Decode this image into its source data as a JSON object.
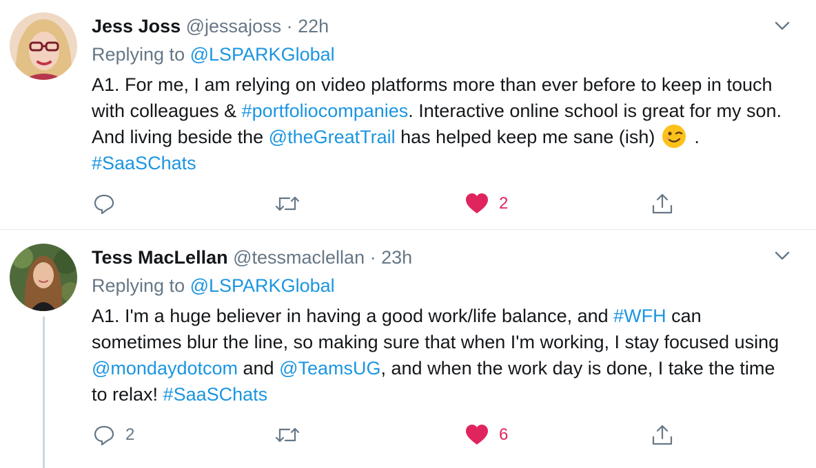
{
  "tweets": [
    {
      "author_name": "Jess Joss",
      "handle": "@jessajoss",
      "separator": "·",
      "time": "22h",
      "replying_prefix": "Replying to",
      "replying_to": "@LSPARKGlobal",
      "body": {
        "t1": "A1. For me, I am relying on video platforms more than ever before to keep in touch with colleagues & ",
        "h1": "#portfoliocompanies",
        "t2": ". Interactive online school is great for my son. And living beside the ",
        "m1": "@theGreatTrail",
        "t3": " has helped keep me sane (ish) ",
        "t4": " . ",
        "h2": "#SaaSChats"
      },
      "emoji": "winking-face",
      "reply_count": "",
      "retweet_count": "",
      "like_count": "2"
    },
    {
      "author_name": "Tess MacLellan",
      "handle": "@tessmaclellan",
      "separator": "·",
      "time": "23h",
      "replying_prefix": "Replying to",
      "replying_to": "@LSPARKGlobal",
      "body": {
        "t1": "A1. I'm a huge believer in having a good work/life balance, and ",
        "h1": "#WFH",
        "t2": " can sometimes blur the line, so making sure that when I'm working, I stay focused using ",
        "m1": "@mondaydotcom",
        "t3": " and ",
        "m2": "@TeamsUG",
        "t4": ", and when the work day is done, I take the time to relax! ",
        "h2": "#SaaSChats"
      },
      "reply_count": "2",
      "retweet_count": "",
      "like_count": "6"
    }
  ],
  "colors": {
    "link": "#1b95e0",
    "muted": "#657786",
    "like": "#e0245e",
    "divider": "#e6ecf0"
  },
  "icons": [
    "chevron-down-icon",
    "reply-icon",
    "retweet-icon",
    "heart-icon",
    "share-icon"
  ]
}
